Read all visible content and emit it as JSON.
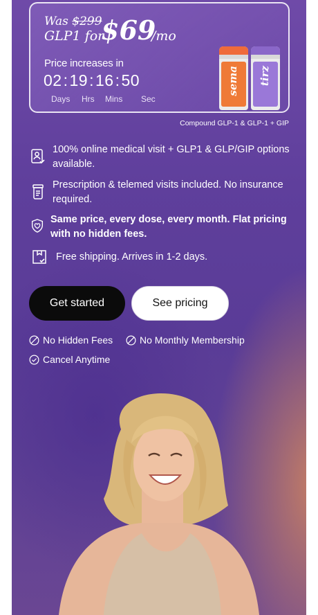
{
  "promo": {
    "was_prefix": "Was",
    "was_price": "$299",
    "product": "GLP1 for",
    "price": "$69",
    "per": "/mo",
    "increase_label": "Price increases in",
    "timer": {
      "days": "02",
      "hrs": "19",
      "mins": "16",
      "sec": "50"
    },
    "units": {
      "days": "Days",
      "hrs": "Hrs",
      "mins": "Mins",
      "sec": "Sec"
    },
    "vials": [
      {
        "word": "sema",
        "color": "#ef7a37"
      },
      {
        "word": "tirz",
        "color": "#9a78d8"
      }
    ]
  },
  "compound_note": "Compound GLP-1 & GLP-1 + GIP",
  "features": [
    {
      "icon": "doctor-badge-icon",
      "text": "100% online medical visit + GLP1 & GLP/GIP options available."
    },
    {
      "icon": "prescription-bottle-icon",
      "text": "Prescription & telemed visits included. No insurance required."
    },
    {
      "icon": "shield-heart-icon",
      "text": "Same price, every dose, every month. Flat pricing with no hidden fees."
    },
    {
      "icon": "box-check-icon",
      "text": "Free shipping. Arrives in 1-2 days."
    }
  ],
  "buttons": {
    "primary": "Get started",
    "secondary": "See pricing"
  },
  "tags": [
    "No Hidden Fees",
    "No Monthly Membership",
    "Cancel Anytime"
  ],
  "colors": {
    "accent_orange": "#ef7a37",
    "accent_purple": "#5f3f9c",
    "button_dark": "#0b0b0b"
  }
}
